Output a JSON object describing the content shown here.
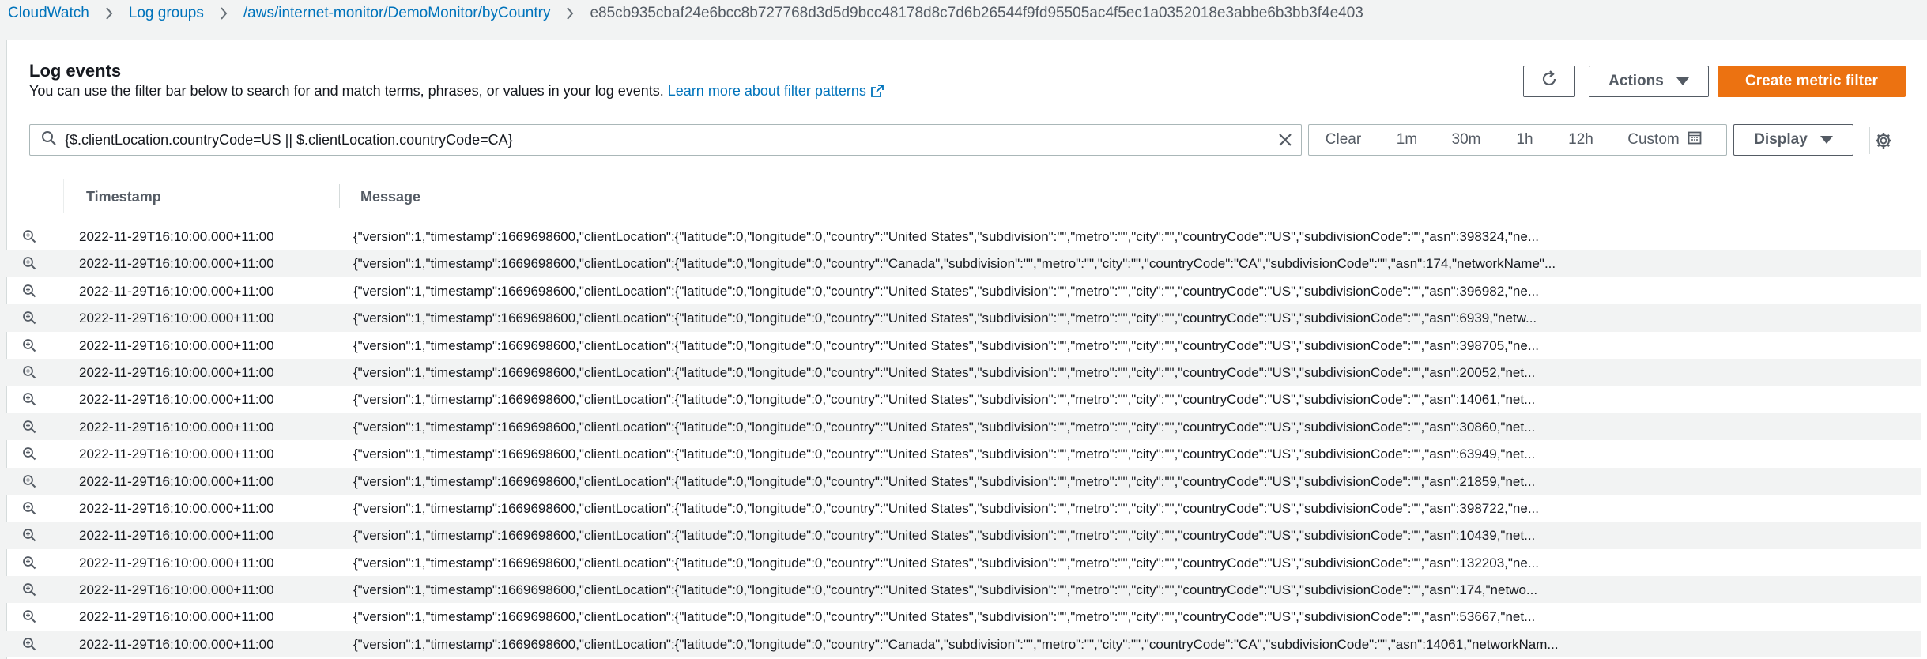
{
  "breadcrumb": {
    "items": [
      "CloudWatch",
      "Log groups",
      "/aws/internet-monitor/DemoMonitor/byCountry"
    ],
    "current": "e85cb935cbaf24e6bcc8b727768d3d5d9bcc48178d8c7d6b26544f9fd95505ac4f5ec1a0352018e3abbe6b3bb3f4e403"
  },
  "panel": {
    "title": "Log events",
    "description": "You can use the filter bar below to search for and match terms, phrases, or values in your log events.",
    "learn_more": "Learn more about filter patterns"
  },
  "toolbar": {
    "actions_label": "Actions",
    "create_label": "Create metric filter",
    "display_label": "Display"
  },
  "filter": {
    "value": "{$.clientLocation.countryCode=US || $.clientLocation.countryCode=CA}"
  },
  "time_range": {
    "clear": "Clear",
    "m1": "1m",
    "m30": "30m",
    "h1": "1h",
    "h12": "12h",
    "custom": "Custom"
  },
  "table": {
    "columns": {
      "timestamp": "Timestamp",
      "message": "Message"
    },
    "rows": [
      {
        "timestamp": "2022-11-29T16:10:00.000+11:00",
        "message": "{\"version\":1,\"timestamp\":1669698600,\"clientLocation\":{\"latitude\":0,\"longitude\":0,\"country\":\"United States\",\"subdivision\":\"\",\"metro\":\"\",\"city\":\"\",\"countryCode\":\"US\",\"subdivisionCode\":\"\",\"asn\":398324,\"ne..."
      },
      {
        "timestamp": "2022-11-29T16:10:00.000+11:00",
        "message": "{\"version\":1,\"timestamp\":1669698600,\"clientLocation\":{\"latitude\":0,\"longitude\":0,\"country\":\"Canada\",\"subdivision\":\"\",\"metro\":\"\",\"city\":\"\",\"countryCode\":\"CA\",\"subdivisionCode\":\"\",\"asn\":174,\"networkName\"..."
      },
      {
        "timestamp": "2022-11-29T16:10:00.000+11:00",
        "message": "{\"version\":1,\"timestamp\":1669698600,\"clientLocation\":{\"latitude\":0,\"longitude\":0,\"country\":\"United States\",\"subdivision\":\"\",\"metro\":\"\",\"city\":\"\",\"countryCode\":\"US\",\"subdivisionCode\":\"\",\"asn\":396982,\"ne..."
      },
      {
        "timestamp": "2022-11-29T16:10:00.000+11:00",
        "message": "{\"version\":1,\"timestamp\":1669698600,\"clientLocation\":{\"latitude\":0,\"longitude\":0,\"country\":\"United States\",\"subdivision\":\"\",\"metro\":\"\",\"city\":\"\",\"countryCode\":\"US\",\"subdivisionCode\":\"\",\"asn\":6939,\"netw..."
      },
      {
        "timestamp": "2022-11-29T16:10:00.000+11:00",
        "message": "{\"version\":1,\"timestamp\":1669698600,\"clientLocation\":{\"latitude\":0,\"longitude\":0,\"country\":\"United States\",\"subdivision\":\"\",\"metro\":\"\",\"city\":\"\",\"countryCode\":\"US\",\"subdivisionCode\":\"\",\"asn\":398705,\"ne..."
      },
      {
        "timestamp": "2022-11-29T16:10:00.000+11:00",
        "message": "{\"version\":1,\"timestamp\":1669698600,\"clientLocation\":{\"latitude\":0,\"longitude\":0,\"country\":\"United States\",\"subdivision\":\"\",\"metro\":\"\",\"city\":\"\",\"countryCode\":\"US\",\"subdivisionCode\":\"\",\"asn\":20052,\"net..."
      },
      {
        "timestamp": "2022-11-29T16:10:00.000+11:00",
        "message": "{\"version\":1,\"timestamp\":1669698600,\"clientLocation\":{\"latitude\":0,\"longitude\":0,\"country\":\"United States\",\"subdivision\":\"\",\"metro\":\"\",\"city\":\"\",\"countryCode\":\"US\",\"subdivisionCode\":\"\",\"asn\":14061,\"net..."
      },
      {
        "timestamp": "2022-11-29T16:10:00.000+11:00",
        "message": "{\"version\":1,\"timestamp\":1669698600,\"clientLocation\":{\"latitude\":0,\"longitude\":0,\"country\":\"United States\",\"subdivision\":\"\",\"metro\":\"\",\"city\":\"\",\"countryCode\":\"US\",\"subdivisionCode\":\"\",\"asn\":30860,\"net..."
      },
      {
        "timestamp": "2022-11-29T16:10:00.000+11:00",
        "message": "{\"version\":1,\"timestamp\":1669698600,\"clientLocation\":{\"latitude\":0,\"longitude\":0,\"country\":\"United States\",\"subdivision\":\"\",\"metro\":\"\",\"city\":\"\",\"countryCode\":\"US\",\"subdivisionCode\":\"\",\"asn\":63949,\"net..."
      },
      {
        "timestamp": "2022-11-29T16:10:00.000+11:00",
        "message": "{\"version\":1,\"timestamp\":1669698600,\"clientLocation\":{\"latitude\":0,\"longitude\":0,\"country\":\"United States\",\"subdivision\":\"\",\"metro\":\"\",\"city\":\"\",\"countryCode\":\"US\",\"subdivisionCode\":\"\",\"asn\":21859,\"net..."
      },
      {
        "timestamp": "2022-11-29T16:10:00.000+11:00",
        "message": "{\"version\":1,\"timestamp\":1669698600,\"clientLocation\":{\"latitude\":0,\"longitude\":0,\"country\":\"United States\",\"subdivision\":\"\",\"metro\":\"\",\"city\":\"\",\"countryCode\":\"US\",\"subdivisionCode\":\"\",\"asn\":398722,\"ne..."
      },
      {
        "timestamp": "2022-11-29T16:10:00.000+11:00",
        "message": "{\"version\":1,\"timestamp\":1669698600,\"clientLocation\":{\"latitude\":0,\"longitude\":0,\"country\":\"United States\",\"subdivision\":\"\",\"metro\":\"\",\"city\":\"\",\"countryCode\":\"US\",\"subdivisionCode\":\"\",\"asn\":10439,\"net..."
      },
      {
        "timestamp": "2022-11-29T16:10:00.000+11:00",
        "message": "{\"version\":1,\"timestamp\":1669698600,\"clientLocation\":{\"latitude\":0,\"longitude\":0,\"country\":\"United States\",\"subdivision\":\"\",\"metro\":\"\",\"city\":\"\",\"countryCode\":\"US\",\"subdivisionCode\":\"\",\"asn\":132203,\"ne..."
      },
      {
        "timestamp": "2022-11-29T16:10:00.000+11:00",
        "message": "{\"version\":1,\"timestamp\":1669698600,\"clientLocation\":{\"latitude\":0,\"longitude\":0,\"country\":\"United States\",\"subdivision\":\"\",\"metro\":\"\",\"city\":\"\",\"countryCode\":\"US\",\"subdivisionCode\":\"\",\"asn\":174,\"netwo..."
      },
      {
        "timestamp": "2022-11-29T16:10:00.000+11:00",
        "message": "{\"version\":1,\"timestamp\":1669698600,\"clientLocation\":{\"latitude\":0,\"longitude\":0,\"country\":\"United States\",\"subdivision\":\"\",\"metro\":\"\",\"city\":\"\",\"countryCode\":\"US\",\"subdivisionCode\":\"\",\"asn\":53667,\"net..."
      },
      {
        "timestamp": "2022-11-29T16:10:00.000+11:00",
        "message": "{\"version\":1,\"timestamp\":1669698600,\"clientLocation\":{\"latitude\":0,\"longitude\":0,\"country\":\"Canada\",\"subdivision\":\"\",\"metro\":\"\",\"city\":\"\",\"countryCode\":\"CA\",\"subdivisionCode\":\"\",\"asn\":14061,\"networkNam..."
      }
    ]
  },
  "colors": {
    "link": "#0073bb",
    "primary": "#ec7211",
    "border": "#aab7b8",
    "text": "#16191f",
    "muted": "#545b64"
  }
}
